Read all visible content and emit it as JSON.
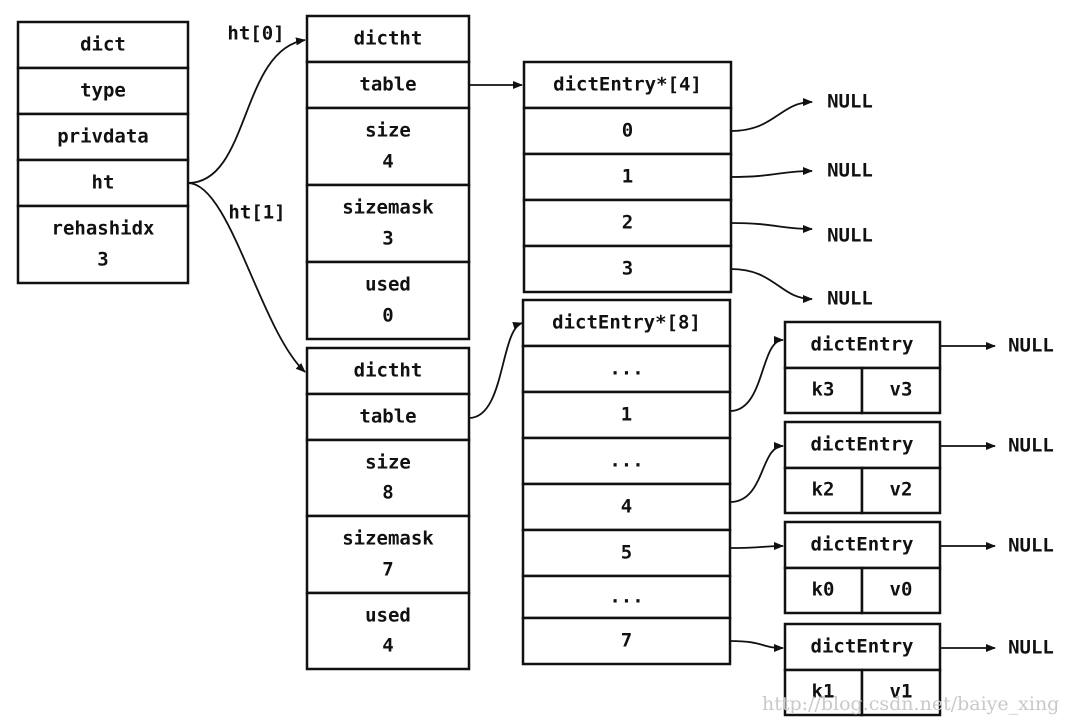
{
  "dict": {
    "fields": [
      {
        "label": "dict"
      },
      {
        "label": "type"
      },
      {
        "label": "privdata"
      },
      {
        "label": "ht"
      },
      {
        "label": "rehashidx",
        "value": "3"
      }
    ]
  },
  "pointer_labels": {
    "ht0": "ht[0]",
    "ht1": "ht[1]"
  },
  "dictht": [
    {
      "fields": [
        {
          "label": "dictht"
        },
        {
          "label": "table"
        },
        {
          "label": "size",
          "value": "4"
        },
        {
          "label": "sizemask",
          "value": "3"
        },
        {
          "label": "used",
          "value": "0"
        }
      ]
    },
    {
      "fields": [
        {
          "label": "dictht"
        },
        {
          "label": "table"
        },
        {
          "label": "size",
          "value": "8"
        },
        {
          "label": "sizemask",
          "value": "7"
        },
        {
          "label": "used",
          "value": "4"
        }
      ]
    }
  ],
  "arrays": [
    {
      "header": "dictEntry*[4]",
      "slots": [
        "0",
        "1",
        "2",
        "3"
      ]
    },
    {
      "header": "dictEntry*[8]",
      "slots": [
        "...",
        "1",
        "...",
        "4",
        "5",
        "...",
        "7"
      ]
    }
  ],
  "null_label": "NULL",
  "entries": [
    {
      "header": "dictEntry",
      "key": "k3",
      "value": "v3"
    },
    {
      "header": "dictEntry",
      "key": "k2",
      "value": "v2"
    },
    {
      "header": "dictEntry",
      "key": "k0",
      "value": "v0"
    },
    {
      "header": "dictEntry",
      "key": "k1",
      "value": "v1"
    }
  ],
  "watermark": "http://blog.csdn.net/baiye_xing"
}
